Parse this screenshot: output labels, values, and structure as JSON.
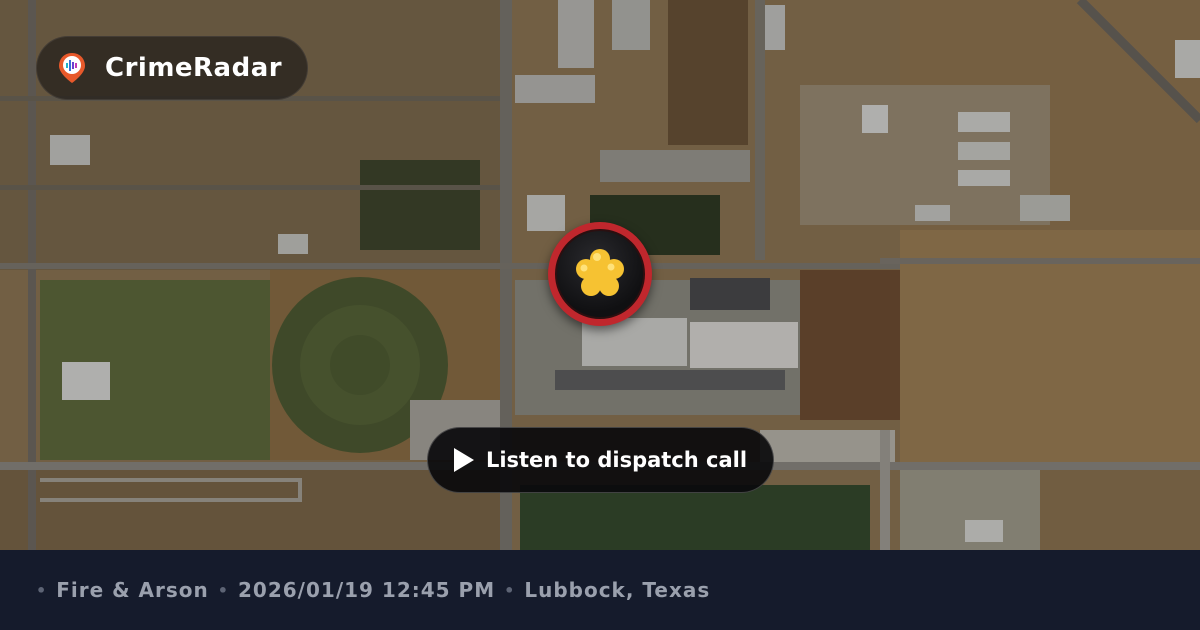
{
  "brand": {
    "name": "CrimeRadar",
    "logo_icon": "crimeradar-pin-icon"
  },
  "map": {
    "type": "satellite",
    "marker_icon": "fire-incident-icon"
  },
  "action": {
    "play_label": "Listen to dispatch call",
    "play_icon": "play-icon"
  },
  "incident": {
    "category": "Fire & Arson",
    "datetime": "2026/01/19 12:45 PM",
    "location": "Lubbock, Texas",
    "separator": "•"
  },
  "colors": {
    "marker_ring": "#c0272d",
    "footer_bg": "#151b2c",
    "footer_text": "#9aa0ad"
  }
}
